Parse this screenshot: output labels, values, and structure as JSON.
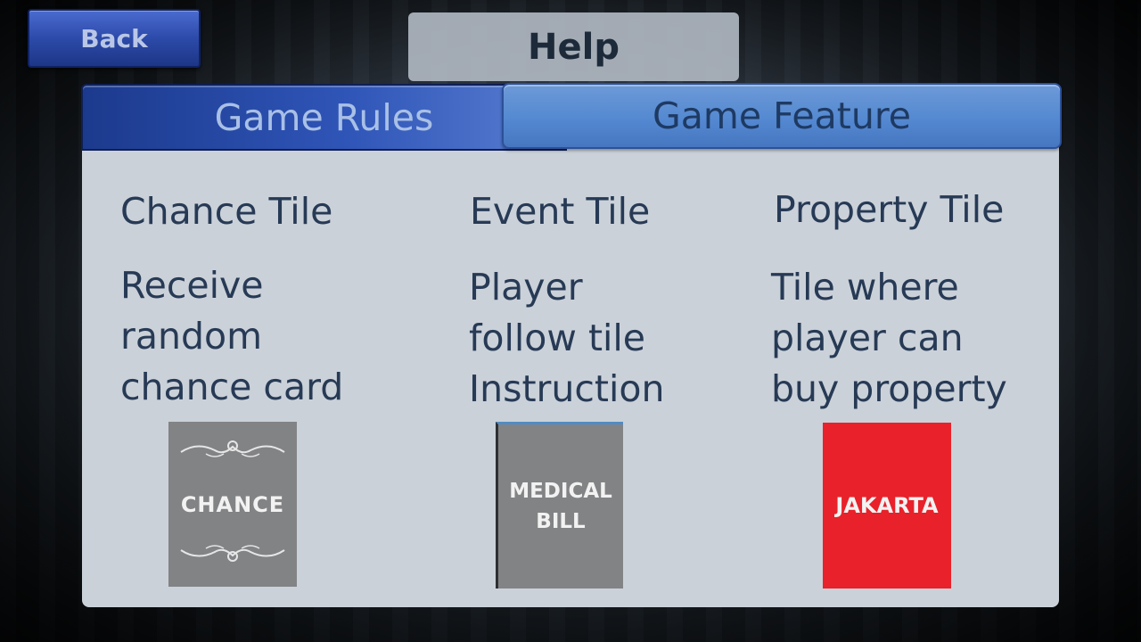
{
  "header": {
    "back_label": "Back",
    "title": "Help"
  },
  "tabs": [
    {
      "label": "Game Rules",
      "active": true
    },
    {
      "label": "Game Feature",
      "active": false
    }
  ],
  "columns": [
    {
      "title": "Chance Tile",
      "description": [
        "Receive",
        "random",
        "chance card"
      ],
      "tile": {
        "lines": [
          "CHANCE"
        ],
        "color": "#828385",
        "icon": "ornament-icon"
      }
    },
    {
      "title": "Event Tile",
      "description": [
        "Player",
        "follow tile",
        "Instruction"
      ],
      "tile": {
        "lines": [
          "MEDICAL",
          "BILL"
        ],
        "color": "#828385"
      }
    },
    {
      "title": "Property Tile",
      "description": [
        "Tile where",
        "player can",
        "buy property"
      ],
      "tile": {
        "lines": [
          "JAKARTA"
        ],
        "color": "#e8212a"
      }
    }
  ]
}
